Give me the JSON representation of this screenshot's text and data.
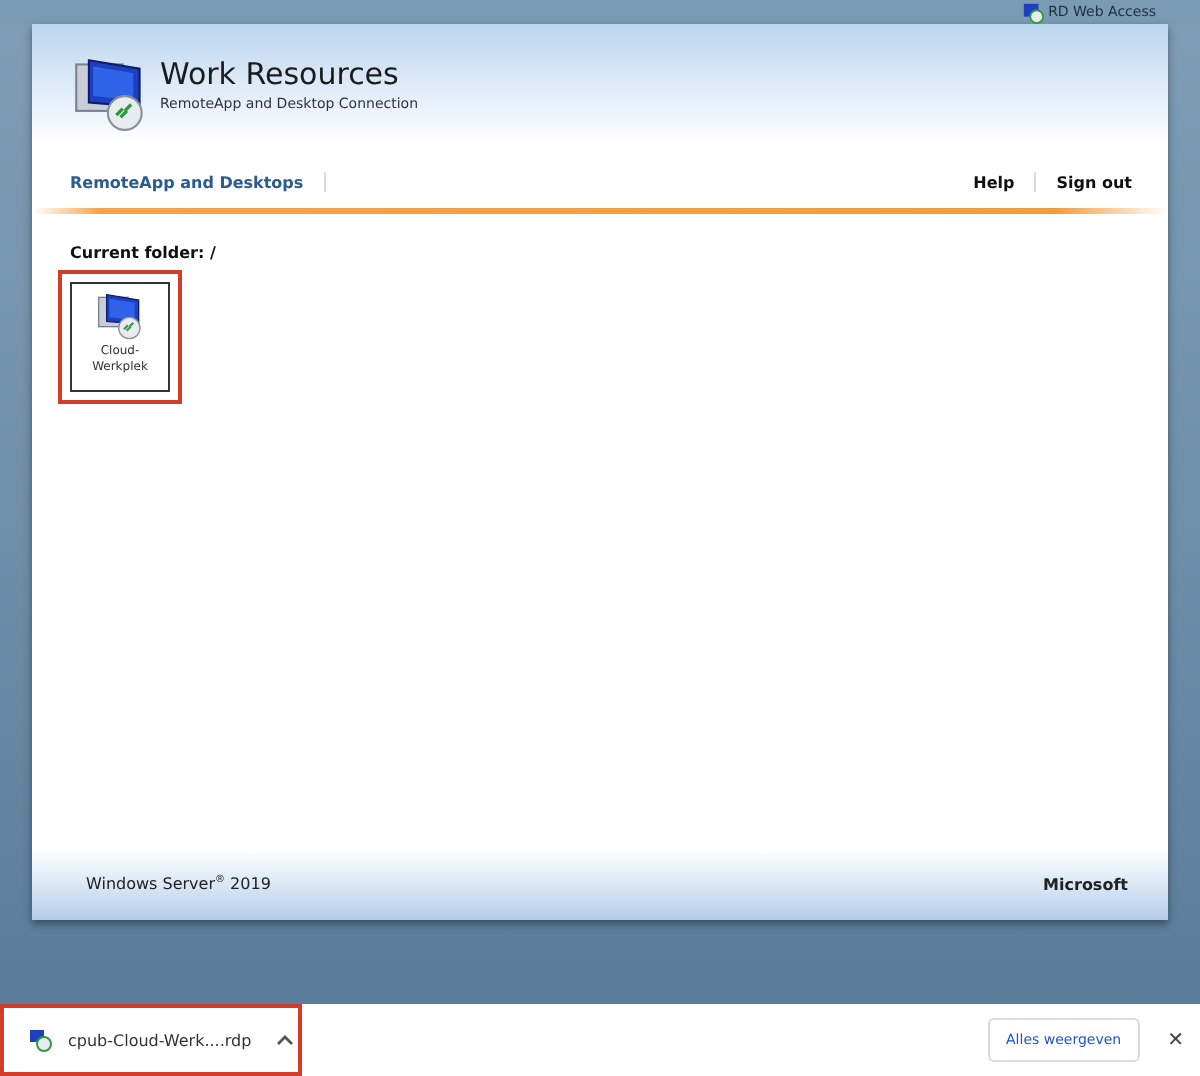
{
  "top_bar": {
    "label": "RD Web Access"
  },
  "header": {
    "title": "Work Resources",
    "subtitle": "RemoteApp and Desktop Connection"
  },
  "nav": {
    "items": [
      {
        "label": "RemoteApp and Desktops",
        "selected": true
      }
    ],
    "links": [
      "Help",
      "Sign out"
    ]
  },
  "folder": {
    "label": "Current folder: /",
    "items": [
      {
        "label": "Cloud-Werkplek",
        "highlighted": true
      }
    ]
  },
  "footer": {
    "product": "Windows Server$^{®}$ 2019",
    "brand": "Microsoft"
  },
  "download_bar": {
    "items": [
      {
        "filename": "cpub-Cloud-Werk....rdp",
        "highlighted": true
      }
    ],
    "show_all": "Alles weergeven",
    "close": "✕"
  }
}
